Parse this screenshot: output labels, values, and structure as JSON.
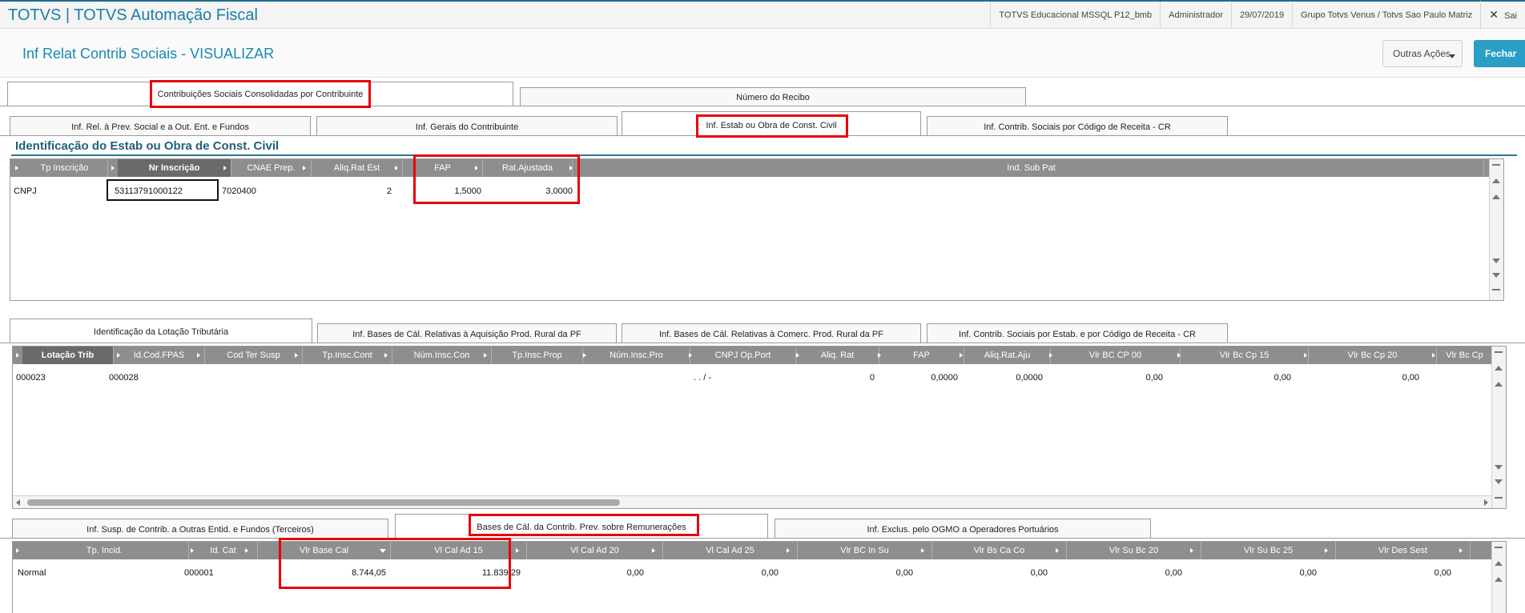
{
  "topbar": {
    "title": "TOTVS | TOTVS Automação Fiscal",
    "environment": "TOTVS Educacional MSSQL P12_bmb",
    "user": "Administrador",
    "date": "29/07/2019",
    "company": "Grupo Totvs Venus / Totvs Sao Paulo Matriz",
    "exit": "Sai"
  },
  "header": {
    "title": "Inf Relat Contrib Sociais - VISUALIZAR",
    "more_actions": "Outras Ações",
    "close": "Fechar"
  },
  "tabs_level1": [
    "Contribuições Sociais Consolidadas por Contribuinte",
    "Número do Recibo"
  ],
  "tabs_level2": [
    "Inf. Rel. à Prev. Social e a Out. Ent. e Fundos",
    "Inf. Gerais do Contribuinte",
    "Inf. Estab ou Obra de Const. Civil",
    "Inf. Contrib. Sociais por Código de Receita - CR"
  ],
  "section_title": "Identificação do Estab ou Obra de Const. Civil",
  "grid1": {
    "columns": [
      "Tp Inscrição",
      "Nr Inscrição",
      "CNAE Prep.",
      "Aliq.Rat Est",
      "FAP",
      "Rat.Ajustada",
      "Ind. Sub Pat"
    ],
    "row": [
      "CNPJ",
      "53113791000122",
      "7020400",
      "2",
      "1,5000",
      "3,0000",
      ""
    ]
  },
  "tabs_level3": [
    "Identificação da Lotação Tributária",
    "Inf. Bases de Cál. Relativas à Aquisição Prod. Rural da PF",
    "Inf. Bases de Cál. Relativas à Comerc. Prod. Rural da PF",
    "Inf. Contrib. Sociais por Estab. e por Código de Receita - CR"
  ],
  "grid2": {
    "columns": [
      "Lotação Trib",
      "Id.Cod.FPAS",
      "Cod Ter Susp",
      "Tp.Insc.Cont",
      "Núm.Insc.Con",
      "Tp.Insc.Prop",
      "Núm.Insc.Pro",
      "CNPJ Op.Port",
      "Aliq. Rat",
      "FAP",
      "Aliq.Rat.Aju",
      "Vlr BC CP 00",
      "Vlr Bc Cp 15",
      "Vlr Bc Cp 20",
      "Vlr Bc Cp"
    ],
    "row": [
      "000023",
      "000028",
      "",
      "",
      "",
      "",
      "",
      ". . /   -",
      "0",
      "0,0000",
      "0,0000",
      "0,00",
      "0,00",
      "0,00",
      ""
    ]
  },
  "tabs_level4": [
    "Inf. Susp. de Contrib. a Outras Entid. e Fundos (Terceiros)",
    "Bases de Cál. da Contrib. Prev. sobre Remunerações",
    "Inf. Exclus. pelo OGMO a Operadores Portuários"
  ],
  "grid3": {
    "columns": [
      "Tp. Incid.",
      "Id. Cat",
      "Vlr Base Cal",
      "Vl Cal Ad 15",
      "Vl Cal Ad 20",
      "Vl Cal Ad 25",
      "Vlr BC In Su",
      "Vlr Bs Ca Co",
      "Vlr Su Bc 20",
      "Vlr Su Bc 25",
      "Vlr Des Sest"
    ],
    "row": [
      "Normal",
      "000001",
      "8.744,05",
      "11.839,29",
      "0,00",
      "0,00",
      "0,00",
      "0,00",
      "0,00",
      "0,00",
      "0,00"
    ]
  }
}
